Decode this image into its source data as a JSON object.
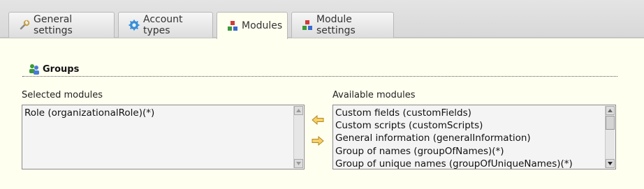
{
  "tabs": [
    {
      "label": "General settings",
      "icon": "wrench-icon"
    },
    {
      "label": "Account types",
      "icon": "gear-icon"
    },
    {
      "label": "Modules",
      "icon": "modules-icon",
      "active": true
    },
    {
      "label": "Module settings",
      "icon": "modules-icon"
    }
  ],
  "section": {
    "title": "Groups",
    "icon": "group-icon"
  },
  "selected": {
    "label": "Selected modules",
    "items": [
      "Role (organizationalRole)(*)"
    ]
  },
  "available": {
    "label": "Available modules",
    "items": [
      "Custom fields (customFields)",
      "Custom scripts (customScripts)",
      "General information (generalInformation)",
      "Group of names (groupOfNames)(*)",
      "Group of unique names (groupOfUniqueNames)(*)"
    ]
  },
  "colors": {
    "panel_background": "#fffff0",
    "arrow_fill": "#f5c542"
  }
}
